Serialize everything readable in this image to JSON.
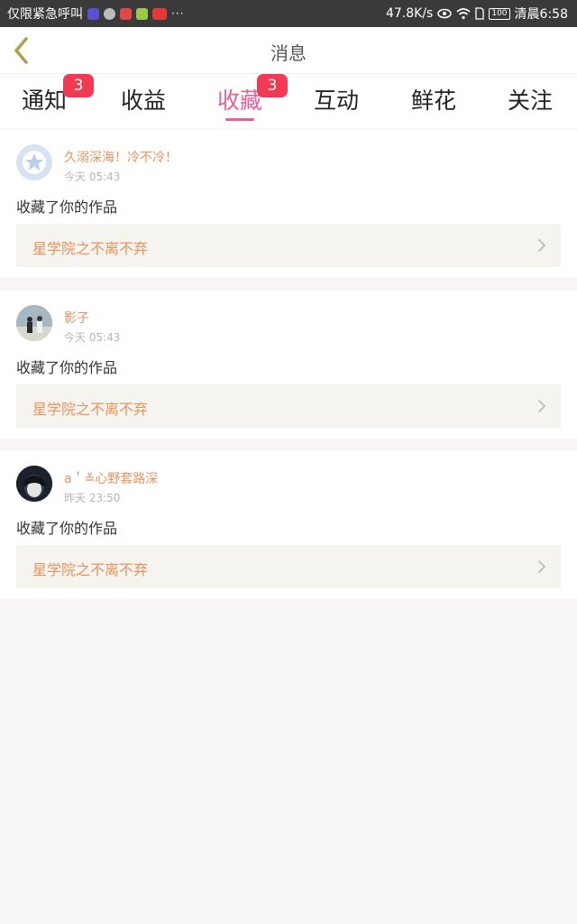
{
  "status_bar": {
    "carrier": "仅限紧急呼叫",
    "speed": "47.8K/s",
    "battery": "100",
    "time": "清晨6:58",
    "dots": "···"
  },
  "nav": {
    "title": "消息"
  },
  "tabs": [
    {
      "label": "通知",
      "badge": "3"
    },
    {
      "label": "收益"
    },
    {
      "label": "收藏",
      "badge": "3",
      "active": true
    },
    {
      "label": "互动"
    },
    {
      "label": "鲜花"
    },
    {
      "label": "关注"
    }
  ],
  "items": [
    {
      "username": "久溺深海！冷不冷！",
      "time": "今天 05:43",
      "action": "收藏了你的作品",
      "work": "星学院之不离不弃"
    },
    {
      "username": "影子",
      "time": "今天 05:43",
      "action": "收藏了你的作品",
      "work": "星学院之不离不弃"
    },
    {
      "username": "a＇≚心野套路深",
      "time": "昨天 23:50",
      "action": "收藏了你的作品",
      "work": "星学院之不离不弃"
    }
  ],
  "colors": {
    "accent": "#e6609a",
    "badge": "#f23a52",
    "username": "#e8925c"
  }
}
